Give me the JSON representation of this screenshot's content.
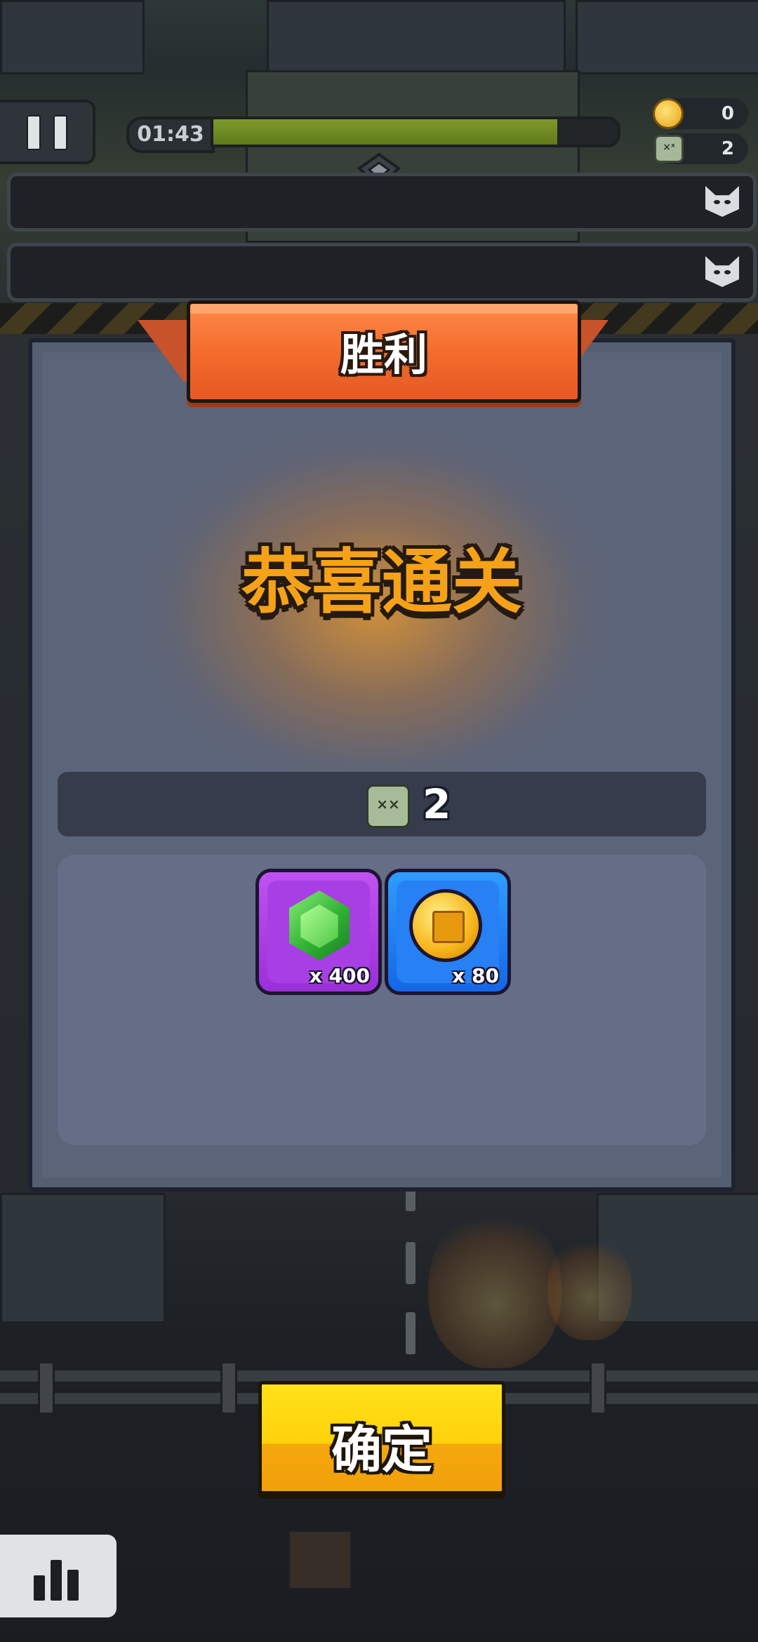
{
  "hud": {
    "timer": "01:43",
    "level_progress": 0.85,
    "coins": "0",
    "kills": "2"
  },
  "dialog": {
    "banner_title": "胜利",
    "congrats_text": "恭喜通关",
    "kill_count": "2",
    "rewards": [
      {
        "name": "gem",
        "quantity": "x 400",
        "color": "#9b2fd8"
      },
      {
        "name": "coin",
        "quantity": "x 80",
        "color": "#1566e6"
      }
    ]
  },
  "confirm_label": "确定",
  "colors": {
    "accent_orange": "#f26a2c",
    "title_gold": "#f5a219",
    "confirm_yellow": "#ffd20a"
  },
  "icons": [
    "pause-icon",
    "coin-icon",
    "zombie-icon",
    "cat-skull-icon",
    "rank-emblem-icon",
    "gem-icon",
    "stats-icon"
  ]
}
